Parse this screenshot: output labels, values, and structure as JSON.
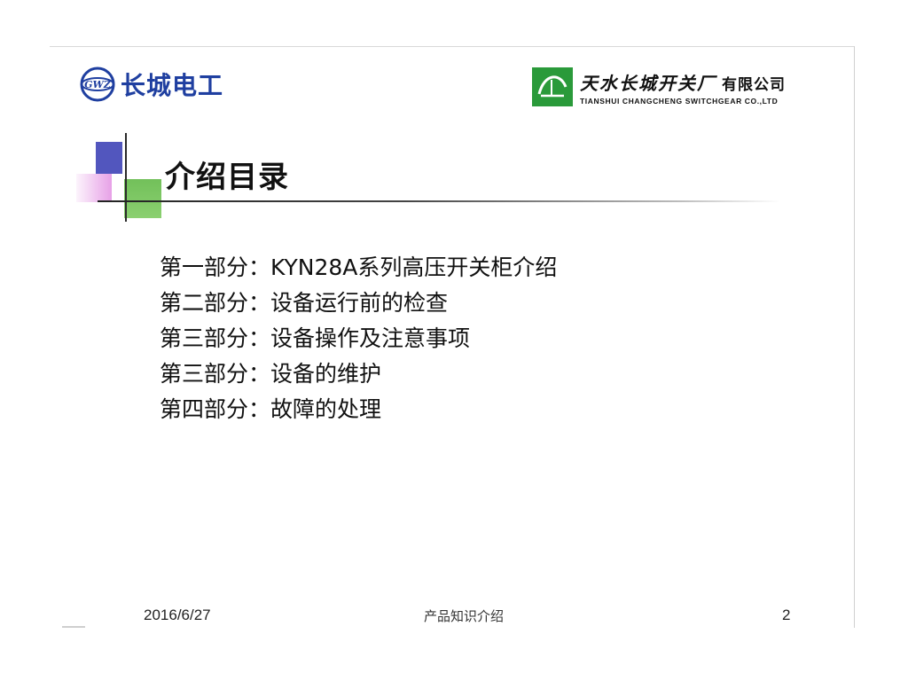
{
  "header": {
    "left_logo": {
      "mark_text": "GWZ",
      "name": "长城电工",
      "color": "#1f3fa0"
    },
    "right_logo": {
      "name_cn": "天水长城开关厂",
      "suffix": "有限公司",
      "name_en": "TIANSHUI CHANGCHENG SWITCHGEAR CO.,LTD",
      "color": "#2a9a3a"
    }
  },
  "slide": {
    "title": "介绍目录",
    "items": [
      "第一部分：KYN28A系列高压开关柜介绍",
      "第二部分：设备运行前的检查",
      "第三部分：设备操作及注意事项",
      "第三部分：设备的维护",
      "第四部分：故障的处理"
    ]
  },
  "footer": {
    "date": "2016/6/27",
    "center": "产品知识介绍",
    "page": "2"
  },
  "colors": {
    "deco_blue": "#4348b8",
    "deco_green": "#72c05a",
    "deco_pink": "#e496e4"
  }
}
